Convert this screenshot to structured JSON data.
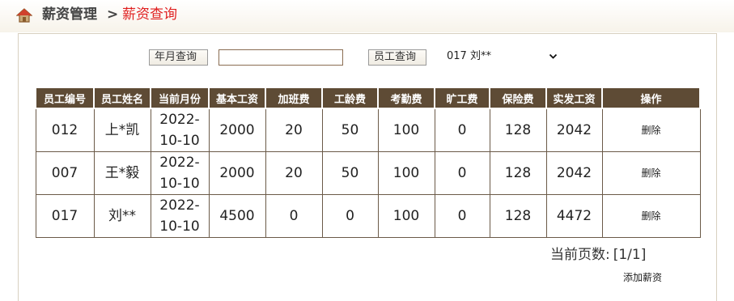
{
  "breadcrumb": {
    "section": "薪资管理",
    "separator": ">",
    "current": "薪资查询"
  },
  "filters": {
    "month_button": "年月查询",
    "month_input_value": "",
    "staff_button": "员工查询",
    "staff_select_value": "017  刘**"
  },
  "table": {
    "headers": [
      "员工编号",
      "员工姓名",
      "当前月份",
      "基本工资",
      "加班费",
      "工龄费",
      "考勤费",
      "旷工费",
      "保险费",
      "实发工资",
      "操作"
    ],
    "rows": [
      {
        "id": "012",
        "name": "上*凯",
        "month": "2022-10-10",
        "base": "2000",
        "overtime": "20",
        "seniority": "50",
        "attendance": "100",
        "absence": "0",
        "insurance": "128",
        "net": "2042",
        "action": "删除"
      },
      {
        "id": "007",
        "name": "王*毅",
        "month": "2022-10-10",
        "base": "2000",
        "overtime": "20",
        "seniority": "50",
        "attendance": "100",
        "absence": "0",
        "insurance": "128",
        "net": "2042",
        "action": "删除"
      },
      {
        "id": "017",
        "name": "刘**",
        "month": "2022-10-10",
        "base": "4500",
        "overtime": "0",
        "seniority": "0",
        "attendance": "100",
        "absence": "0",
        "insurance": "128",
        "net": "4472",
        "action": "删除"
      }
    ]
  },
  "pager": {
    "label": "当前页数:",
    "value": "[1/1]"
  },
  "add_link": "添加薪资",
  "colors": {
    "header_bg": "#5e4b35",
    "current_crumb": "#e02020",
    "border": "#6b5a48"
  }
}
